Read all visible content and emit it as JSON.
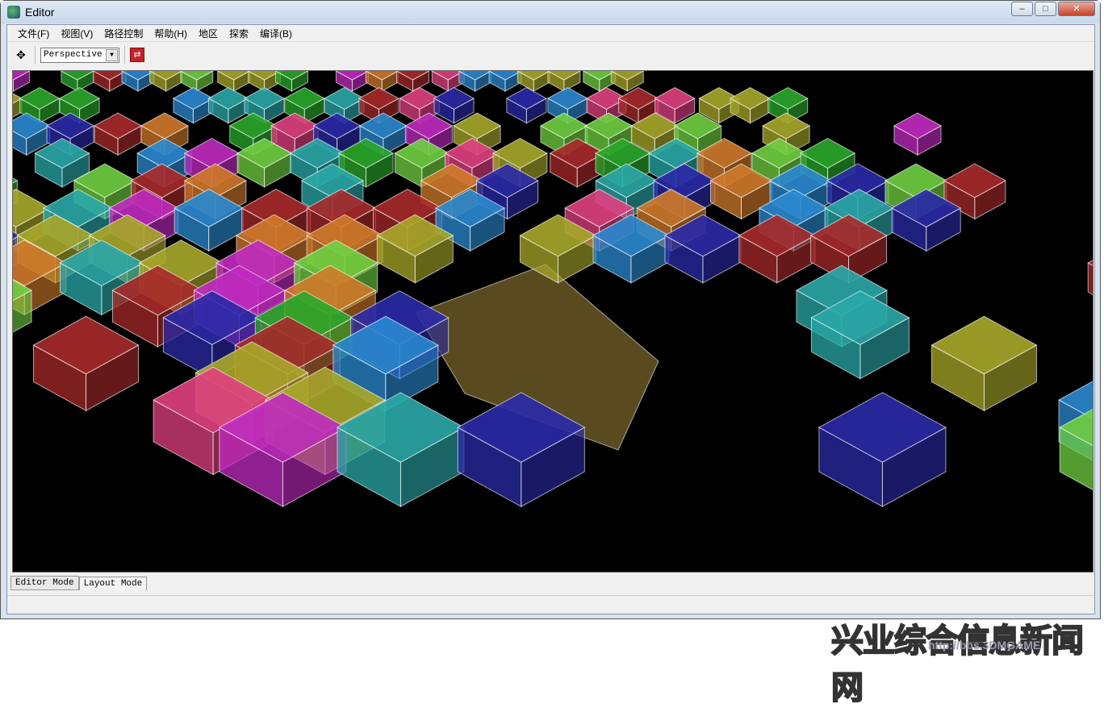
{
  "window": {
    "title": "Editor",
    "controls": [
      "–",
      "□",
      "✕"
    ]
  },
  "menu": [
    "文件(F)",
    "视图(V)",
    "路径控制",
    "帮助(H)",
    "地区",
    "探索",
    "编译(B)"
  ],
  "toolbar": {
    "view_select": "Perspective",
    "move_icon": "move-arrows-icon",
    "refresh_icon": "red-swap-icon"
  },
  "tabs": [
    {
      "label": "Editor Mode",
      "active": false
    },
    {
      "label": "Layout Mode",
      "active": true
    }
  ],
  "palette": [
    "#a82a2a",
    "#2a2aa8",
    "#2aa82a",
    "#2aa8a8",
    "#a8a82a",
    "#c02ac0",
    "#2a8ad0",
    "#d07a2a",
    "#e04080",
    "#70d040"
  ],
  "watermark": {
    "text": "兴业综合信息新闻网",
    "url": "http://bbs.3DMGAME"
  }
}
